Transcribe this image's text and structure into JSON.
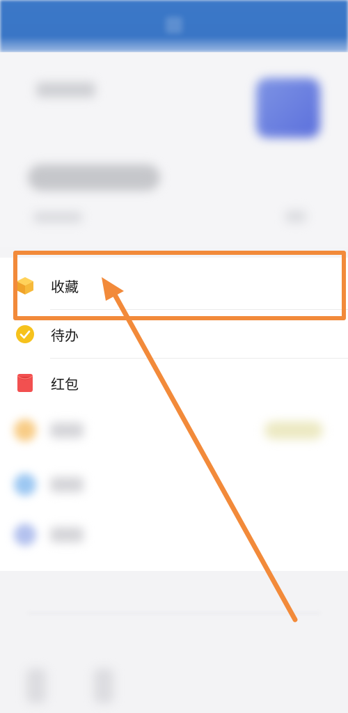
{
  "menu": {
    "items": [
      {
        "label": "收藏",
        "icon": "cube-icon",
        "color": "#f5b731"
      },
      {
        "label": "待办",
        "icon": "check-circle-icon",
        "color": "#f6c21c"
      },
      {
        "label": "红包",
        "icon": "red-envelope-icon",
        "color": "#f25050"
      }
    ]
  },
  "annotation": {
    "color": "#f28a3a",
    "highlight_target": "收藏"
  }
}
